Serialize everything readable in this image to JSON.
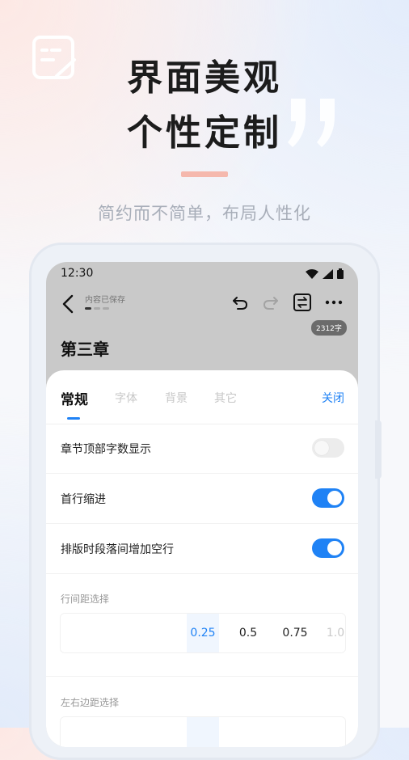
{
  "headline": {
    "line1": "界面美观",
    "line2": "个性定制"
  },
  "subtitle": "简约而不简单，布局人性化",
  "status_bar": {
    "time": "12:30"
  },
  "editor": {
    "save_status": "内容已保存",
    "word_count": "2312字",
    "chapter_title": "第三章"
  },
  "settings_sheet": {
    "tabs": [
      {
        "label": "常规"
      },
      {
        "label": "字体"
      },
      {
        "label": "背景"
      },
      {
        "label": "其它"
      }
    ],
    "active_tab": "常规",
    "close_label": "关闭",
    "toggles": [
      {
        "label": "章节顶部字数显示",
        "on": false
      },
      {
        "label": "首行缩进",
        "on": true
      },
      {
        "label": "排版时段落间增加空行",
        "on": true
      }
    ],
    "line_spacing": {
      "label": "行间距选择",
      "options": [
        "0.25",
        "0.5",
        "0.75",
        "1.0"
      ],
      "selected": "0.25"
    },
    "margin": {
      "label": "左右边距选择"
    }
  },
  "colors": {
    "accent": "#1f82f5",
    "headline": "#1c1c1c",
    "accent_bar": "#f5b8ad"
  }
}
